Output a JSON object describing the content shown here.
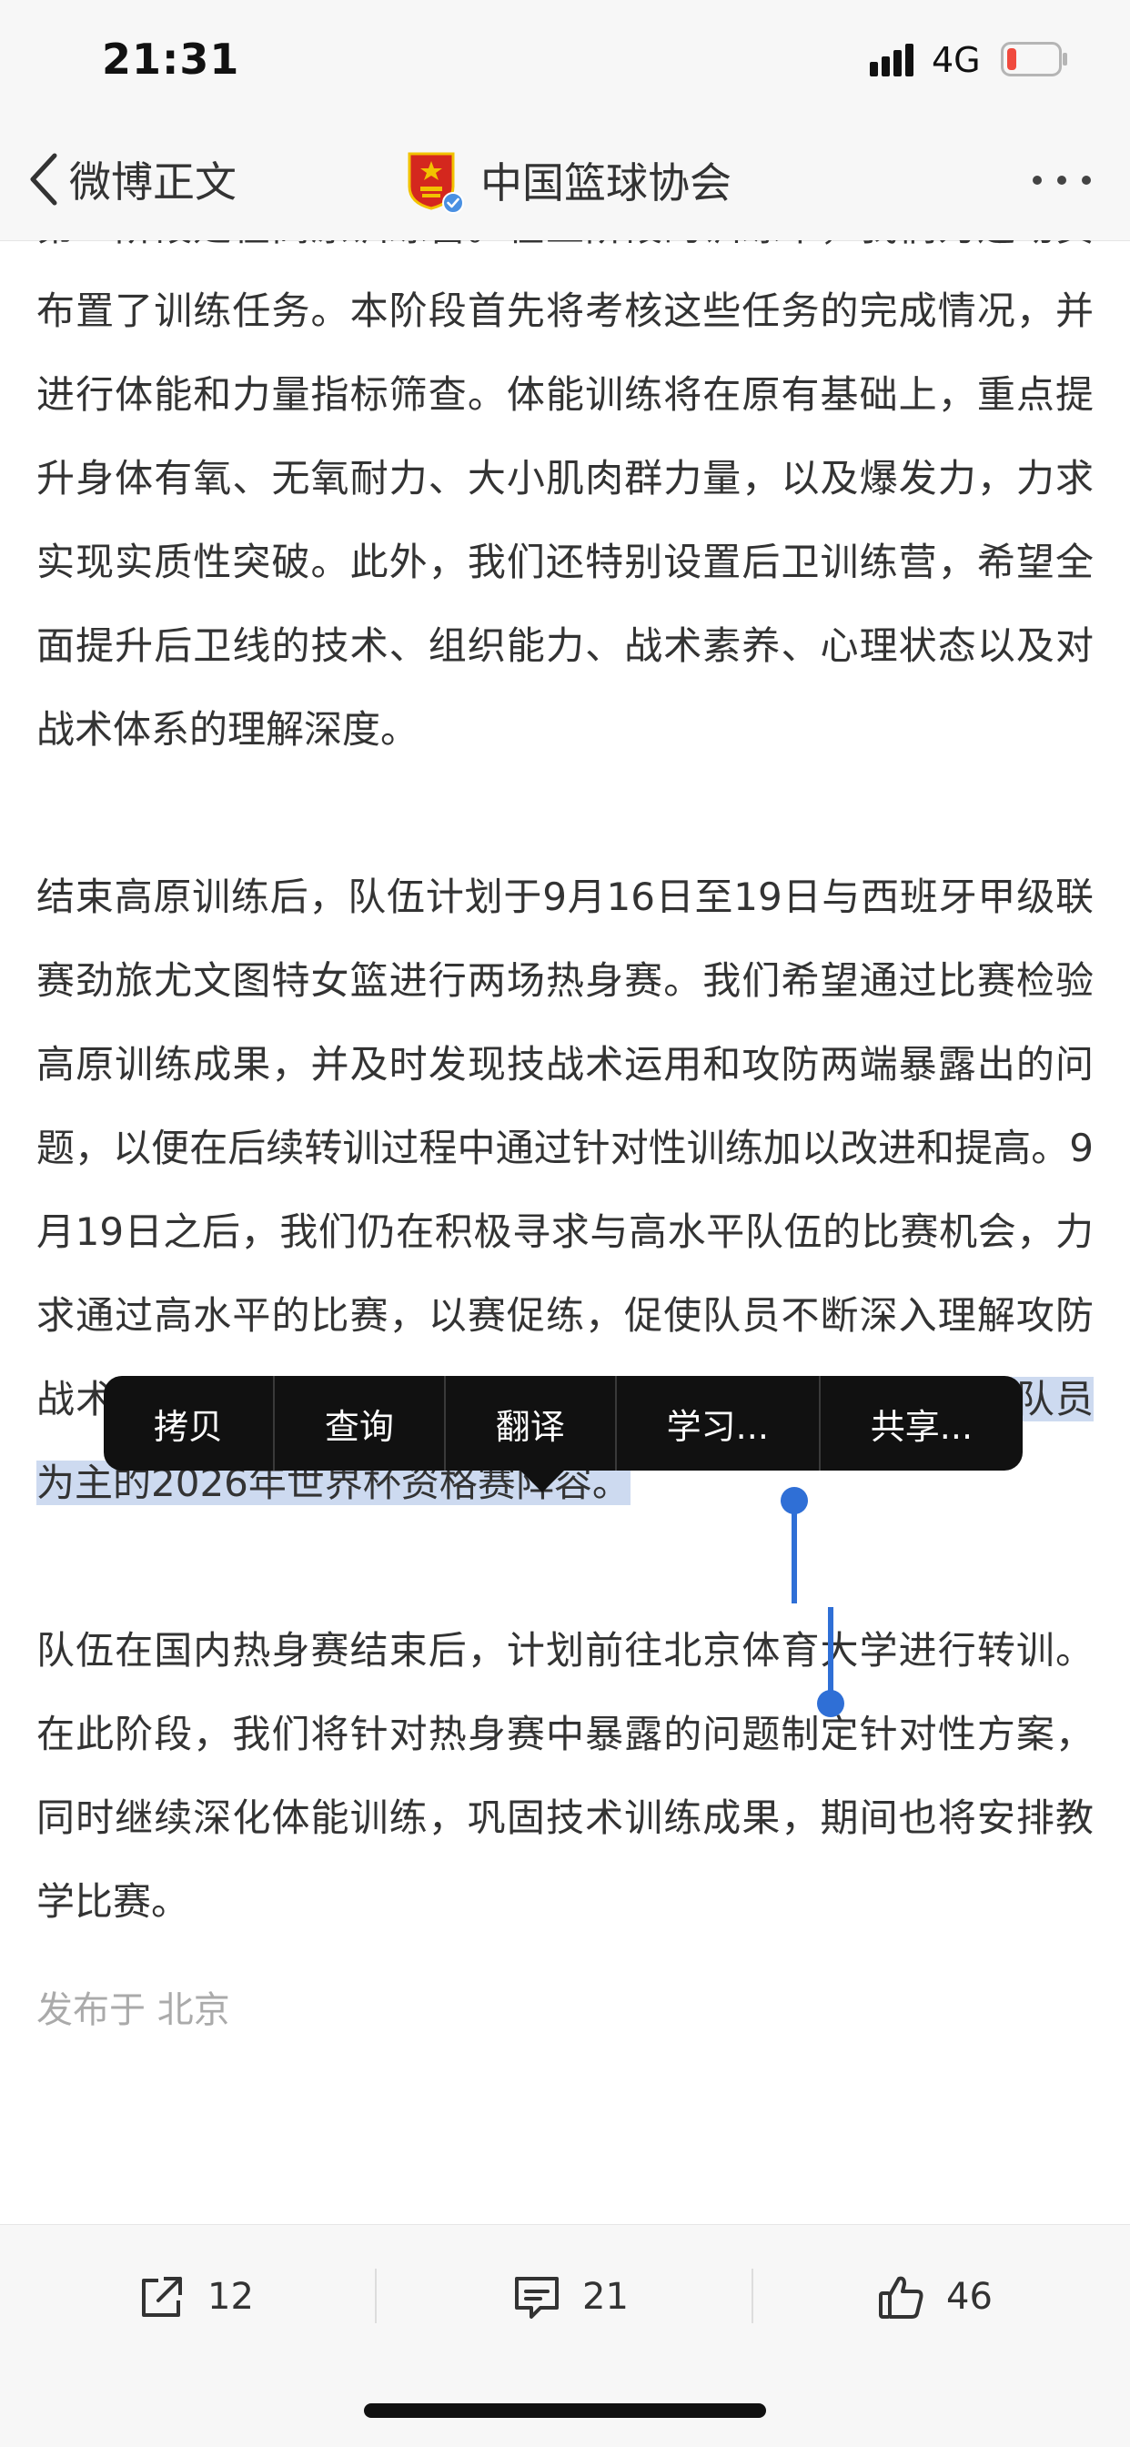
{
  "status_bar": {
    "time": "21:31",
    "network": "4G",
    "battery_color": "#f04a3e"
  },
  "nav": {
    "back_label": "微博正文",
    "account_name": "中国篮球协会",
    "verified_color": "#4a90e2",
    "avatar_color": "#d4271e"
  },
  "article": {
    "paragraphs": [
      {
        "text": "第一阶段是在高原训练营。在上阶段的训练中，我们为运动员布置了训练任务。本阶段首先将考核这些任务的完成情况，并进行体能和力量指标筛查。体能训练将在原有基础上，重点提升身体有氧、无氧耐力、大小肌肉群力量，以及爆发力，力求实现实质性突破。此外，我们还特别设置后卫训练营，希望全面提升后卫线的技术、组织能力、战术素养、心理状态以及对战术体系的理解深度。"
      },
      {
        "text_before": "结束高原训练后，队伍计划于9月16日至19日与西班牙甲级联赛劲旅尤文图特女篮进行两场热身赛。我们希望通过比赛检验高原训练成果，并及时发现技战术运用和攻防两端暴露出的问题，以便在后续转训过程中通过针对性训练加以改进和提高。9月19日之后，我们仍在积极寻求与高水平队伍的比赛机会，力求通过高水平的比赛，以赛促练，促使队员不断深入理解攻防战术体系，并借此机会全面考察队员，",
        "selected_text": "初步选拔以中青年队员为主的2026年世界杯资格赛阵容。"
      },
      {
        "text": "队伍在国内热身赛结束后，计划前往北京体育大学进行转训。在此阶段，我们将针对热身赛中暴露的问题制定针对性方案，同时继续深化体能训练，巩固技术训练成果，期间也将安排教学比赛。"
      }
    ],
    "publish_location": "发布于 北京",
    "selection_color": "#cddaf0",
    "handle_color": "#2f6fd6"
  },
  "context_menu": {
    "items": [
      {
        "label": "拷贝"
      },
      {
        "label": "查询"
      },
      {
        "label": "翻译"
      },
      {
        "label": "学习..."
      },
      {
        "label": "共享..."
      }
    ]
  },
  "actions": {
    "repost_count": "12",
    "comment_count": "21",
    "like_count": "46"
  }
}
